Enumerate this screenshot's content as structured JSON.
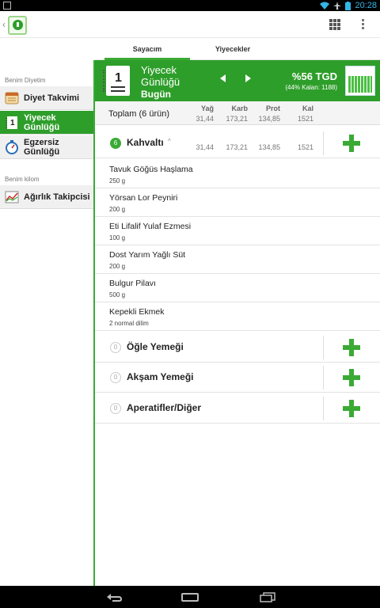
{
  "status_bar": {
    "time": "20:28"
  },
  "tabs": [
    {
      "label": "Sayacım",
      "active": true
    },
    {
      "label": "Yiyecekler",
      "active": false
    }
  ],
  "sidebar": {
    "section1": "Benim Diyetim",
    "items": [
      {
        "label": "Diyet Takvimi",
        "icon": "calendar-icon",
        "active": false
      },
      {
        "label": "Yiyecek Günlüğü",
        "icon": "food-diary-icon",
        "active": true
      },
      {
        "label": "Egzersiz Günlüğü",
        "icon": "stopwatch-icon",
        "active": false
      }
    ],
    "section2": "Benim kilom",
    "items2": [
      {
        "label": "Ağırlık Takipcisi",
        "icon": "weight-chart-icon",
        "active": false
      }
    ]
  },
  "header": {
    "title_line1": "Yiyecek",
    "title_line2": "Günlüğü",
    "date": "Bugün",
    "notebook_number": "1",
    "tgd_percent": "%56 TGD",
    "tgd_remaining": "(44% Kalan: 1188)",
    "accent": "#2e9e2a"
  },
  "totals": {
    "label": "Toplam (6 ürün)",
    "columns": [
      "Yağ",
      "Karb",
      "Prot",
      "Kal"
    ],
    "values": [
      "31,44",
      "173,21",
      "134,85",
      "1521"
    ]
  },
  "meals": [
    {
      "name": "Kahvaltı",
      "count": "6",
      "values": [
        "31,44",
        "173,21",
        "134,85",
        "1521"
      ],
      "foods": [
        {
          "name": "Tavuk Göğüs Haşlama",
          "qty": "250 g"
        },
        {
          "name": "Yörsan Lor Peyniri",
          "qty": "200 g"
        },
        {
          "name": "Eti Lifalif Yulaf Ezmesi",
          "qty": "100 g"
        },
        {
          "name": "Dost Yarım Yağlı Süt",
          "qty": "200 g"
        },
        {
          "name": "Bulgur Pilavı",
          "qty": "500 g"
        },
        {
          "name": "Kepekli Ekmek",
          "qty": "2 normal dilim"
        }
      ]
    },
    {
      "name": "Öğle Yemeği",
      "count": "0"
    },
    {
      "name": "Akşam Yemeği",
      "count": "0"
    },
    {
      "name": "Aperatifler/Diğer",
      "count": "0"
    }
  ]
}
